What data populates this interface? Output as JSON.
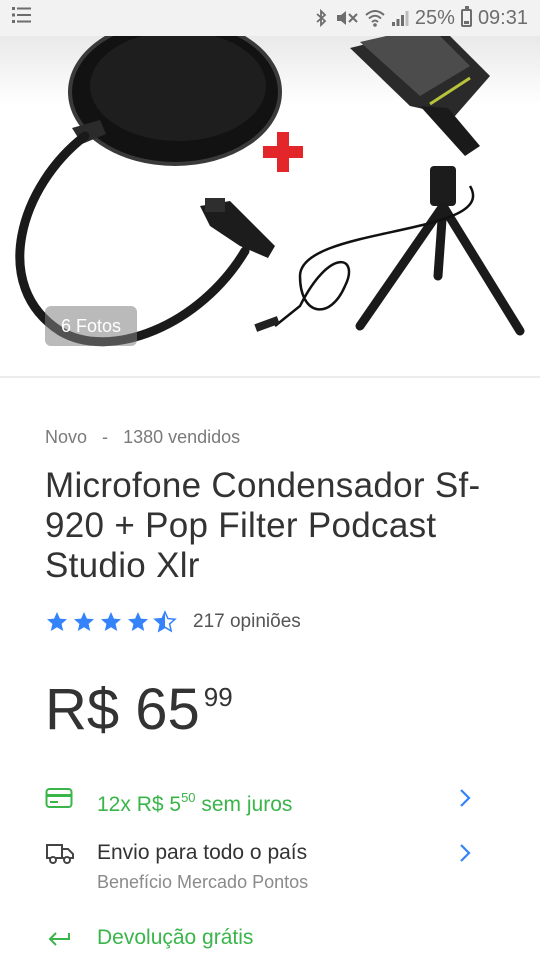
{
  "status_bar": {
    "battery": "25%",
    "time": "09:31",
    "battery_level": 0.25
  },
  "gallery": {
    "photo_count": "6 Fotos"
  },
  "product": {
    "condition": "Novo",
    "separator": "-",
    "sold": "1380 vendidos",
    "title": "Microfone Condensador Sf-920 + Pop Filter Podcast Studio Xlr",
    "rating_value": 4.5,
    "rating_max": 5,
    "reviews": "217 opiniões",
    "price_main": "R$ 65",
    "price_cents": "99"
  },
  "installments": {
    "prefix": "12x R$ 5",
    "cents": "50",
    "suffix": "sem juros"
  },
  "shipping": {
    "label": "Envio para todo o país",
    "sublabel": "Benefício Mercado Pontos"
  },
  "returns": {
    "label": "Devolução grátis"
  },
  "colors": {
    "accent_green": "#39b54a",
    "star_blue": "#3483fa",
    "chevron_blue": "#3483fa"
  }
}
